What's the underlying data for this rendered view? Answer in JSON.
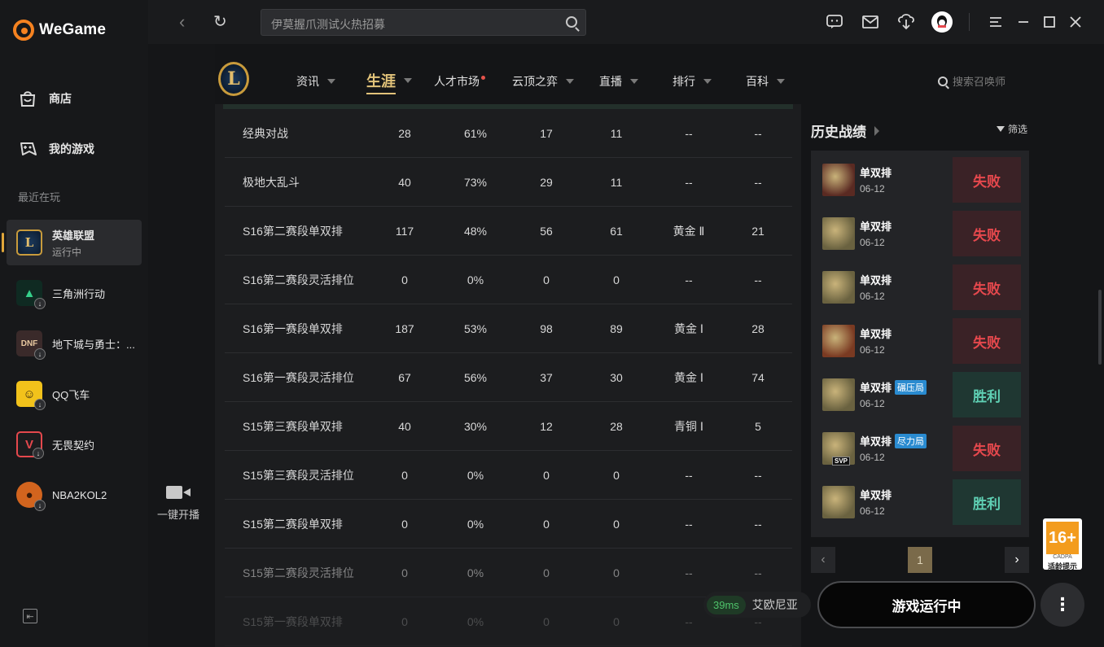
{
  "brand": {
    "name": "WeGame",
    "accent": "#f58220"
  },
  "sidebar": {
    "nav": [
      {
        "label": "商店",
        "icon": "shop-bag-icon"
      },
      {
        "label": "我的游戏",
        "icon": "gamepad-icon"
      }
    ],
    "recent_label": "最近在玩",
    "games": [
      {
        "name": "英雄联盟",
        "status": "运行中",
        "icon": "lol-icon",
        "active": true
      },
      {
        "name": "三角洲行动",
        "icon": "delta-force-icon",
        "downloadable": true
      },
      {
        "name": "地下城与勇士：...",
        "icon": "dnf-icon",
        "downloadable": true
      },
      {
        "name": "QQ飞车",
        "icon": "qq-speed-icon",
        "downloadable": true
      },
      {
        "name": "无畏契约",
        "icon": "valorant-icon",
        "downloadable": true
      },
      {
        "name": "NBA2KOL2",
        "icon": "nba2k-icon",
        "downloadable": true
      }
    ],
    "collapse_icon": "collapse-sidebar-icon"
  },
  "live": {
    "label": "一键开播",
    "icon": "video-camera-icon"
  },
  "topbar": {
    "search_placeholder": "伊莫握爪测试火热招募",
    "icons": [
      "chat-bubble-icon",
      "mail-icon",
      "download-icon",
      "avatar-icon",
      "menu-icon",
      "minimize-icon",
      "maximize-icon",
      "close-icon"
    ]
  },
  "gamenav": {
    "tabs": [
      {
        "label": "资讯",
        "caret": true
      },
      {
        "label": "生涯",
        "caret": true,
        "active": true
      },
      {
        "label": "人才市场",
        "dot": true
      },
      {
        "label": "云顶之弈",
        "caret": true
      },
      {
        "label": "直播",
        "caret": true
      },
      {
        "label": "排行",
        "caret": true
      },
      {
        "label": "百科",
        "caret": true
      }
    ],
    "summoner_search_placeholder": "搜索召唤师"
  },
  "stats": {
    "rows": [
      [
        "经典对战",
        "28",
        "61%",
        "17",
        "11",
        "--",
        "--"
      ],
      [
        "极地大乱斗",
        "40",
        "73%",
        "29",
        "11",
        "--",
        "--"
      ],
      [
        "S16第二赛段单双排",
        "117",
        "48%",
        "56",
        "61",
        "黄金 Ⅱ",
        "21"
      ],
      [
        "S16第二赛段灵活排位",
        "0",
        "0%",
        "0",
        "0",
        "--",
        "--"
      ],
      [
        "S16第一赛段单双排",
        "187",
        "53%",
        "98",
        "89",
        "黄金 Ⅰ",
        "28"
      ],
      [
        "S16第一赛段灵活排位",
        "67",
        "56%",
        "37",
        "30",
        "黄金 Ⅰ",
        "74"
      ],
      [
        "S15第三赛段单双排",
        "40",
        "30%",
        "12",
        "28",
        "青铜 Ⅰ",
        "5"
      ],
      [
        "S15第三赛段灵活排位",
        "0",
        "0%",
        "0",
        "0",
        "--",
        "--"
      ],
      [
        "S15第二赛段单双排",
        "0",
        "0%",
        "0",
        "0",
        "--",
        "--"
      ],
      [
        "S15第二赛段灵活排位",
        "0",
        "0%",
        "0",
        "0",
        "--",
        "--"
      ],
      [
        "S15第一赛段单双排",
        "0",
        "0%",
        "0",
        "0",
        "--",
        "--"
      ]
    ]
  },
  "history": {
    "title": "历史战绩",
    "filter_label": "筛选",
    "matches": [
      {
        "mode": "单双排",
        "date": "06-12",
        "result": "失败",
        "win": false,
        "champ_color": "#5a2a22"
      },
      {
        "mode": "单双排",
        "date": "06-12",
        "result": "失败",
        "win": false,
        "champ_color": "#6a6240"
      },
      {
        "mode": "单双排",
        "date": "06-12",
        "result": "失败",
        "win": false,
        "champ_color": "#6a6240"
      },
      {
        "mode": "单双排",
        "date": "06-12",
        "result": "失败",
        "win": false,
        "champ_color": "#7a3a22"
      },
      {
        "mode": "单双排",
        "tag": "碾压局",
        "date": "06-12",
        "result": "胜利",
        "win": true,
        "champ_color": "#6a6240"
      },
      {
        "mode": "单双排",
        "tag": "尽力局",
        "date": "06-12",
        "result": "失败",
        "win": false,
        "champ_color": "#6a6240",
        "svp": "SVP"
      },
      {
        "mode": "单双排",
        "date": "06-12",
        "result": "胜利",
        "win": true,
        "champ_color": "#6a6240"
      }
    ],
    "page": "1"
  },
  "age_rating": {
    "age": "16+",
    "org": "CADPA",
    "label": "适龄提示"
  },
  "bottom": {
    "ping": "39ms",
    "server": "艾欧尼亚",
    "run_label": "游戏运行中",
    "more_icon": "more-vertical-icon"
  }
}
